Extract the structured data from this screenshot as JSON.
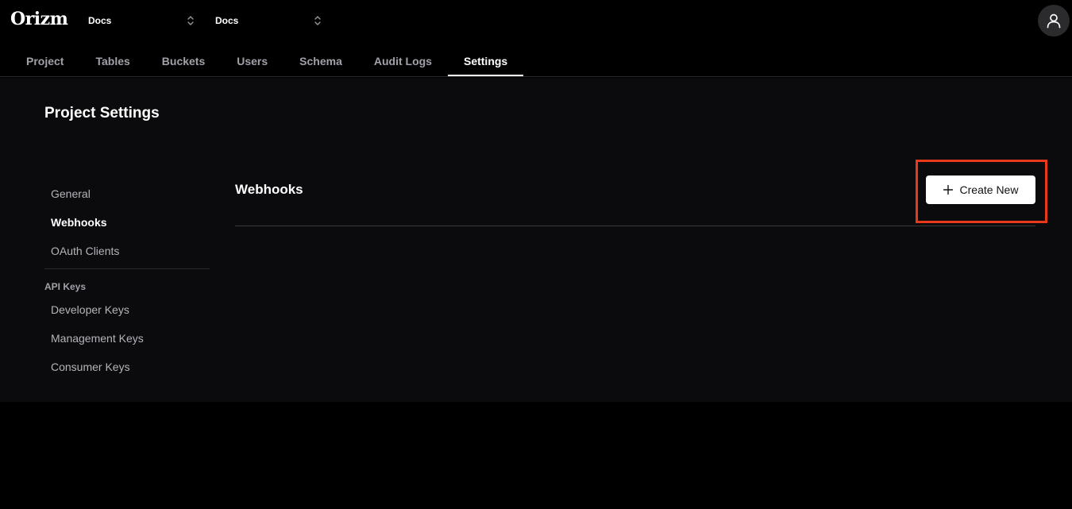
{
  "header": {
    "logo": "Orizm",
    "org_select": {
      "value": "Docs"
    },
    "project_select": {
      "value": "Docs"
    },
    "avatar_icon": "user-icon"
  },
  "tabs": [
    {
      "label": "Project",
      "active": false
    },
    {
      "label": "Tables",
      "active": false
    },
    {
      "label": "Buckets",
      "active": false
    },
    {
      "label": "Users",
      "active": false
    },
    {
      "label": "Schema",
      "active": false
    },
    {
      "label": "Audit Logs",
      "active": false
    },
    {
      "label": "Settings",
      "active": true
    }
  ],
  "page": {
    "title": "Project Settings"
  },
  "sidebar": {
    "items": [
      {
        "label": "General",
        "active": false
      },
      {
        "label": "Webhooks",
        "active": true
      },
      {
        "label": "OAuth Clients",
        "active": false
      }
    ],
    "api_keys": {
      "section_label": "API Keys",
      "items": [
        {
          "label": "Developer Keys"
        },
        {
          "label": "Management Keys"
        },
        {
          "label": "Consumer Keys"
        }
      ]
    }
  },
  "content": {
    "section_title": "Webhooks",
    "create_button": {
      "label": "Create New",
      "icon": "plus-icon"
    }
  },
  "colors": {
    "background": "#000000",
    "panel": "#0b0b0d",
    "accent_highlight": "#e8391a",
    "button_bg": "#ffffff"
  }
}
